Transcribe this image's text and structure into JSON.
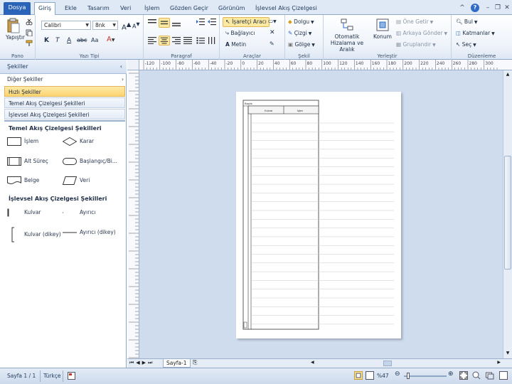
{
  "tabs": [
    {
      "label": "Dosya"
    },
    {
      "label": "Giriş"
    },
    {
      "label": "Ekle"
    },
    {
      "label": "Tasarım"
    },
    {
      "label": "Veri"
    },
    {
      "label": "İşlem"
    },
    {
      "label": "Gözden Geçir"
    },
    {
      "label": "Görünüm"
    },
    {
      "label": "İşlevsel Akış Çizelgesi"
    }
  ],
  "ribbon": {
    "pano": {
      "label": "Pano",
      "paste": "Yapıştır"
    },
    "font": {
      "label": "Yazı Tipi",
      "family": "Calibri",
      "size": "8nk",
      "bold": "K",
      "italic": "T",
      "underline": "A",
      "strike": "abc",
      "case": "Aa",
      "grow": "A",
      "shrink": "A"
    },
    "paragraph": {
      "label": "Paragraf"
    },
    "tools": {
      "label": "Araçlar",
      "pointer": "İşaretçi Aracı",
      "connector": "Bağlayıcı",
      "text": "Metin"
    },
    "shape": {
      "label": "Şekil",
      "fill": "Dolgu",
      "line": "Çizgi",
      "shadow": "Gölge"
    },
    "arrange": {
      "label": "Yerleştir",
      "auto_align": "Otomatik Hizalama ve Aralık",
      "position": "Konum",
      "bring_front": "Öne Getir",
      "send_back": "Arkaya Gönder",
      "group": "Gruplandır"
    },
    "editing": {
      "label": "Düzenleme",
      "find": "Bul",
      "layers": "Katmanlar",
      "select": "Seç"
    }
  },
  "shapes_pane": {
    "title": "Şekiller",
    "more_shapes": "Diğer Şekiller",
    "stencils": [
      {
        "label": "Hızlı Şekiller"
      },
      {
        "label": "Temel Akış Çizelgesi Şekilleri"
      },
      {
        "label": "İşlevsel Akış Çizelgesi Şekilleri"
      }
    ],
    "section1_title": "Temel Akış Çizelgesi Şekilleri",
    "section1_items": [
      {
        "label": "İşlem"
      },
      {
        "label": "Karar"
      },
      {
        "label": "Alt Süreç"
      },
      {
        "label": "Başlangıç/Bi..."
      },
      {
        "label": "Belge"
      },
      {
        "label": "Veri"
      }
    ],
    "section2_title": "İşlevsel Akış Çizelgesi Şekilleri",
    "section2_items": [
      {
        "label": "Kulvar"
      },
      {
        "label": "Ayırıcı"
      },
      {
        "label": "Kulvar (dikey)"
      },
      {
        "label": "Ayırıcı (dikey)"
      }
    ]
  },
  "ruler_labels": [
    "-120",
    "-100",
    "-80",
    "-60",
    "-40",
    "-20",
    "0",
    "20",
    "40",
    "60",
    "80",
    "100",
    "120",
    "140",
    "160",
    "180",
    "200",
    "220",
    "240",
    "260",
    "280",
    "300"
  ],
  "diagram": {
    "title": "Başlık",
    "lanes": [
      {
        "label": "Kulvar"
      },
      {
        "label": "İşlev"
      }
    ]
  },
  "page_tab": "Sayfa-1",
  "status": {
    "page": "Sayfa 1 / 1",
    "language": "Türkçe",
    "zoom": "%47"
  },
  "colors": {
    "accent": "#2a63b8",
    "selected": "#fde99f",
    "canvas": "#cfdcee"
  }
}
